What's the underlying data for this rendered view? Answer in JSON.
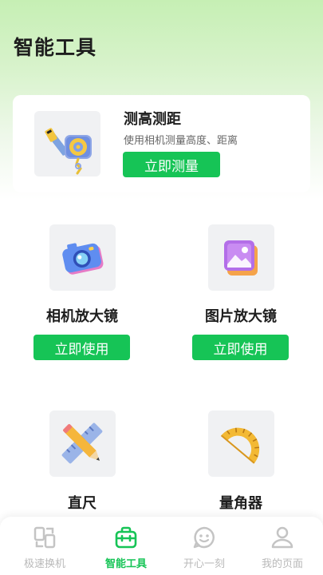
{
  "header": {
    "title": "智能工具"
  },
  "featured": {
    "title": "测高测距",
    "description": "使用相机测量高度、距离",
    "button_label": "立即测量",
    "icon": "tape-measure-icon"
  },
  "tools": [
    {
      "name": "相机放大镜",
      "button_label": "立即使用",
      "icon": "camera-icon"
    },
    {
      "name": "图片放大镜",
      "button_label": "立即使用",
      "icon": "picture-icon"
    },
    {
      "name": "直尺",
      "icon": "ruler-pencil-icon"
    },
    {
      "name": "量角器",
      "icon": "protractor-icon"
    }
  ],
  "bottom_nav": {
    "active_index": 1,
    "items": [
      {
        "label": "极速换机",
        "icon": "phone-transfer-icon"
      },
      {
        "label": "智能工具",
        "icon": "toolbox-icon"
      },
      {
        "label": "开心一刻",
        "icon": "smile-face-icon"
      },
      {
        "label": "我的页面",
        "icon": "person-icon"
      }
    ]
  },
  "colors": {
    "accent": "#16c456",
    "nav_inactive": "#b9b9b9"
  }
}
